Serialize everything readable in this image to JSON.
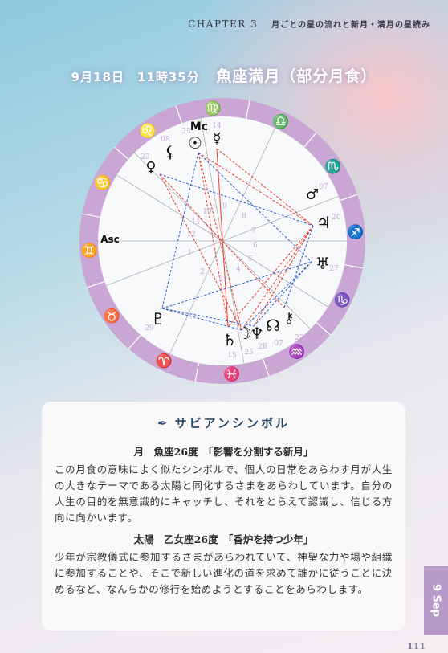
{
  "header": {
    "chapter": "CHAPTER 3",
    "subtitle": "月ごとの星の流れと新月・満月の星読み"
  },
  "title": {
    "datetime": "9月18日　11時35分",
    "name": "魚座満月（部分月食）"
  },
  "chart": {
    "ring_color": "#c9a6d3",
    "signs": [
      "♍",
      "♌",
      "♋",
      "♊",
      "♉",
      "♈",
      "♓",
      "♒",
      "♑",
      "♐",
      "♏",
      "♎"
    ],
    "planets": {
      "mc": "Mc",
      "asc": "Asc",
      "sun": "☉",
      "mercury": "☿",
      "lilith": "⚸",
      "venus": "♀",
      "mars": "♂",
      "jupiter": "♃",
      "uranus": "♅",
      "chiron": "⚷",
      "node": "☊",
      "neptune": "♆",
      "moon": "☽",
      "saturn": "♄",
      "pluto": "♇"
    },
    "cusp_degrees": [
      "25",
      "14",
      "08",
      "23",
      "07",
      "20",
      "27",
      "22",
      "07",
      "28",
      "25",
      "15",
      "29"
    ],
    "houses": [
      "1",
      "2",
      "3",
      "4",
      "5",
      "6",
      "7",
      "8",
      "9",
      "10",
      "11",
      "12"
    ],
    "aspects": [
      [
        "sun",
        "jupiter",
        "red"
      ],
      [
        "mercury",
        "jupiter",
        "red"
      ],
      [
        "sun",
        "saturn",
        "red"
      ],
      [
        "mercury",
        "saturn",
        "redsolid"
      ],
      [
        "sun",
        "moon",
        "red"
      ],
      [
        "venus",
        "moon",
        "red"
      ],
      [
        "venus",
        "chiron",
        "red"
      ],
      [
        "jupiter",
        "moon",
        "red"
      ],
      [
        "jupiter",
        "saturn",
        "red"
      ],
      [
        "jupiter",
        "neptune",
        "red"
      ],
      [
        "venus",
        "jupiter",
        "blue"
      ],
      [
        "sun",
        "uranus",
        "blue"
      ],
      [
        "sun",
        "pluto",
        "blue"
      ],
      [
        "pluto",
        "uranus",
        "blue"
      ],
      [
        "pluto",
        "neptune",
        "blue"
      ],
      [
        "pluto",
        "moon",
        "blue"
      ],
      [
        "uranus",
        "moon",
        "blue"
      ],
      [
        "jupiter",
        "chiron",
        "blue"
      ],
      [
        "uranus",
        "neptune",
        "blue"
      ]
    ]
  },
  "sabian": {
    "heading": "サビアンシンボル",
    "moon_title": "月　魚座26度　「影響を分割する新月」",
    "moon_text": "この月食の意味によく似たシンボルで、個人の日常をあらわす月が人生の大きなテーマである太陽と同化するさまをあらわしています。自分の人生の目的を無意識的にキャッチし、それをとらえて認識し、信じる方向に向かいます。",
    "sun_title": "太陽　乙女座26度　「香炉を持つ少年」",
    "sun_text": "少年が宗教儀式に参加するさまがあらわれていて、神聖な力や場や組織に参加することや、そこで新しい進化の道を求めて誰かに従うことに決めるなど、なんらかの修行を始めようとすることをあらわします。"
  },
  "side_tab": "9 Sep",
  "page_number": "111"
}
